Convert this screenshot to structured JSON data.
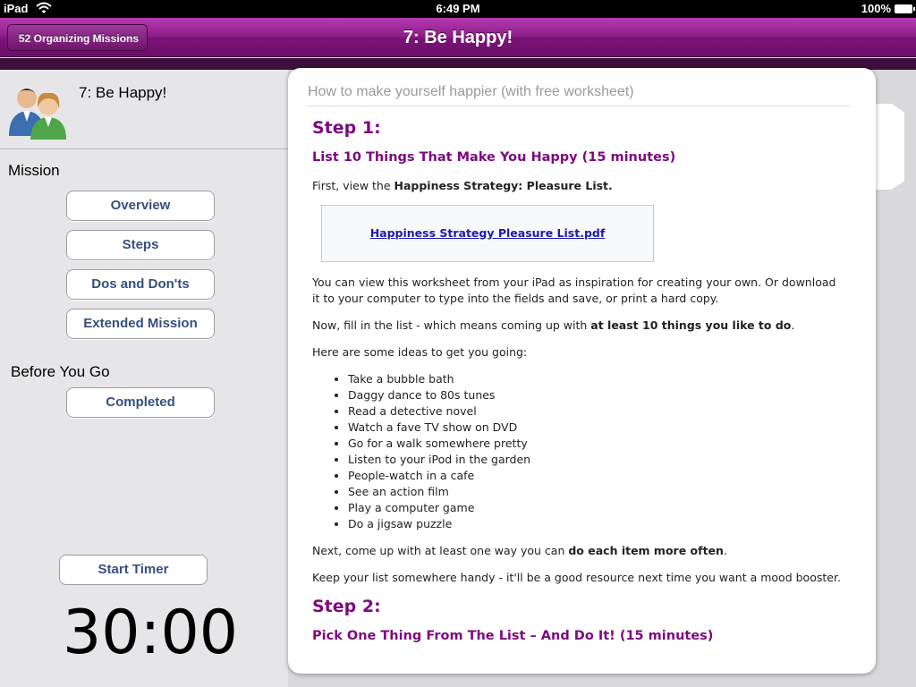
{
  "status_bar": {
    "carrier": "iPad",
    "time": "6:49 PM",
    "battery": "100%"
  },
  "nav": {
    "back_label": "52 Organizing Missions",
    "title": "7: Be Happy!"
  },
  "sidebar": {
    "mission_title": "7: Be Happy!",
    "mission_section": "Mission",
    "mission_buttons": [
      "Overview",
      "Steps",
      "Dos and Don'ts",
      "Extended Mission"
    ],
    "before_section": "Before You Go",
    "completed_label": "Completed",
    "timer_button": "Start Timer",
    "timer_value": "30:00"
  },
  "content": {
    "header": "How to make yourself happier (with free worksheet)",
    "step1_heading": "Step 1:",
    "step1_sub": "List 10 Things That Make You Happy (15 minutes)",
    "p1_pre": "First, view the ",
    "p1_bold": "Happiness Strategy: Pleasure List.",
    "pdf_link": "Happiness Strategy Pleasure List.pdf",
    "p2": "You can view this worksheet from your iPad as inspiration for creating your own. Or download it to your computer to type into the fields and save, or print a hard copy.",
    "p3_pre": "Now, fill in the list - which means coming up with ",
    "p3_bold": "at least 10 things you like to do",
    "p3_post": ".",
    "p4": "Here are some ideas to get you going:",
    "ideas": [
      "Take a bubble bath",
      "Daggy dance to 80s tunes",
      "Read a detective novel",
      "Watch a fave TV show on DVD",
      "Go for a walk somewhere pretty",
      "Listen to your iPod in the garden",
      "People-watch in a cafe",
      "See an action film",
      "Play a computer game",
      "Do a jigsaw puzzle"
    ],
    "p5_pre": "Next, come up with at least one way you can ",
    "p5_bold": "do each item more often",
    "p5_post": ".",
    "p6": "Keep your list somewhere handy - it'll be a good resource next time you want a mood booster.",
    "step2_heading": "Step 2:",
    "step2_sub": "Pick One Thing From The List – And Do It! (15 minutes)"
  },
  "colors": {
    "nav_purple": "#8c1e88",
    "heading_purple": "#7c0a7f",
    "button_text": "#35507f",
    "link_blue": "#1d1ca8"
  },
  "icons": {
    "wifi": "wifi-icon",
    "battery": "battery-icon",
    "avatar": "people-avatar-icon",
    "back": "back-arrow-icon"
  }
}
